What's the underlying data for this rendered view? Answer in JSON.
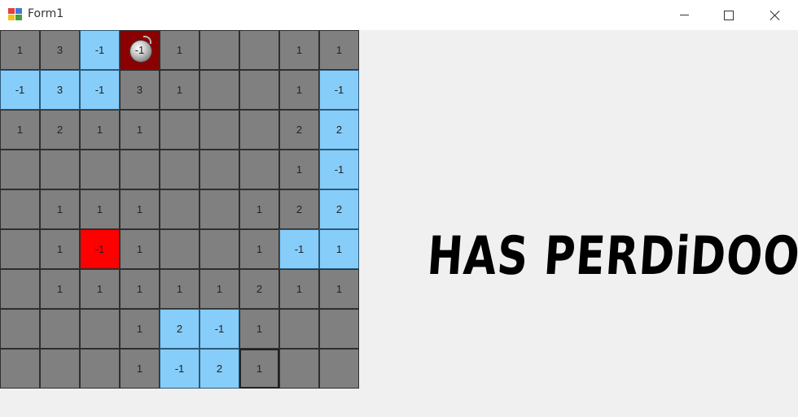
{
  "window": {
    "title": "Form1",
    "controls": {
      "minimize": "minimize-icon",
      "maximize": "maximize-icon",
      "close": "close-icon"
    }
  },
  "board": {
    "rows": 9,
    "cols": 9,
    "cells": [
      [
        {
          "text": "1",
          "state": "gray"
        },
        {
          "text": "3",
          "state": "gray"
        },
        {
          "text": "-1",
          "state": "blue"
        },
        {
          "text": "-1",
          "state": "bomb"
        },
        {
          "text": "1",
          "state": "gray"
        },
        {
          "text": "",
          "state": "gray"
        },
        {
          "text": "",
          "state": "gray"
        },
        {
          "text": "1",
          "state": "gray"
        },
        {
          "text": "1",
          "state": "gray"
        }
      ],
      [
        {
          "text": "-1",
          "state": "blue"
        },
        {
          "text": "3",
          "state": "blue"
        },
        {
          "text": "-1",
          "state": "blue"
        },
        {
          "text": "3",
          "state": "gray"
        },
        {
          "text": "1",
          "state": "gray"
        },
        {
          "text": "",
          "state": "gray"
        },
        {
          "text": "",
          "state": "gray"
        },
        {
          "text": "1",
          "state": "gray"
        },
        {
          "text": "-1",
          "state": "blue"
        }
      ],
      [
        {
          "text": "1",
          "state": "gray"
        },
        {
          "text": "2",
          "state": "gray"
        },
        {
          "text": "1",
          "state": "gray"
        },
        {
          "text": "1",
          "state": "gray"
        },
        {
          "text": "",
          "state": "gray"
        },
        {
          "text": "",
          "state": "gray"
        },
        {
          "text": "",
          "state": "gray"
        },
        {
          "text": "2",
          "state": "gray"
        },
        {
          "text": "2",
          "state": "blue"
        }
      ],
      [
        {
          "text": "",
          "state": "gray"
        },
        {
          "text": "",
          "state": "gray"
        },
        {
          "text": "",
          "state": "gray"
        },
        {
          "text": "",
          "state": "gray"
        },
        {
          "text": "",
          "state": "gray"
        },
        {
          "text": "",
          "state": "gray"
        },
        {
          "text": "",
          "state": "gray"
        },
        {
          "text": "1",
          "state": "gray"
        },
        {
          "text": "-1",
          "state": "blue"
        }
      ],
      [
        {
          "text": "",
          "state": "gray"
        },
        {
          "text": "1",
          "state": "gray"
        },
        {
          "text": "1",
          "state": "gray"
        },
        {
          "text": "1",
          "state": "gray"
        },
        {
          "text": "",
          "state": "gray"
        },
        {
          "text": "",
          "state": "gray"
        },
        {
          "text": "1",
          "state": "gray"
        },
        {
          "text": "2",
          "state": "gray"
        },
        {
          "text": "2",
          "state": "blue"
        }
      ],
      [
        {
          "text": "",
          "state": "gray"
        },
        {
          "text": "1",
          "state": "gray"
        },
        {
          "text": "-1",
          "state": "red"
        },
        {
          "text": "1",
          "state": "gray"
        },
        {
          "text": "",
          "state": "gray"
        },
        {
          "text": "",
          "state": "gray"
        },
        {
          "text": "1",
          "state": "gray"
        },
        {
          "text": "-1",
          "state": "blue"
        },
        {
          "text": "1",
          "state": "blue"
        }
      ],
      [
        {
          "text": "",
          "state": "gray"
        },
        {
          "text": "1",
          "state": "gray"
        },
        {
          "text": "1",
          "state": "gray"
        },
        {
          "text": "1",
          "state": "gray"
        },
        {
          "text": "1",
          "state": "gray"
        },
        {
          "text": "1",
          "state": "gray"
        },
        {
          "text": "2",
          "state": "gray"
        },
        {
          "text": "1",
          "state": "gray"
        },
        {
          "text": "1",
          "state": "gray"
        }
      ],
      [
        {
          "text": "",
          "state": "gray"
        },
        {
          "text": "",
          "state": "gray"
        },
        {
          "text": "",
          "state": "gray"
        },
        {
          "text": "1",
          "state": "gray"
        },
        {
          "text": "2",
          "state": "blue"
        },
        {
          "text": "-1",
          "state": "blue"
        },
        {
          "text": "1",
          "state": "gray"
        },
        {
          "text": "",
          "state": "gray"
        },
        {
          "text": "",
          "state": "gray"
        }
      ],
      [
        {
          "text": "",
          "state": "gray"
        },
        {
          "text": "",
          "state": "gray"
        },
        {
          "text": "",
          "state": "gray"
        },
        {
          "text": "1",
          "state": "gray"
        },
        {
          "text": "-1",
          "state": "blue"
        },
        {
          "text": "2",
          "state": "blue"
        },
        {
          "text": "1",
          "state": "outlined"
        },
        {
          "text": "",
          "state": "gray"
        },
        {
          "text": "",
          "state": "gray"
        }
      ]
    ]
  },
  "message": "HAS PERDiDOO",
  "colors": {
    "cell_gray": "#808080",
    "cell_blue": "#87cdf9",
    "cell_red": "#ff0000",
    "cell_bomb": "#8b0000",
    "background": "#f0f0f0"
  }
}
